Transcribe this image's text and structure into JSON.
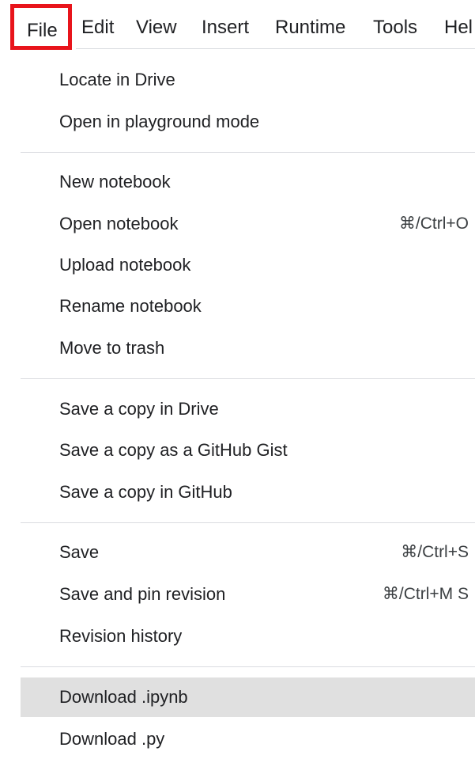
{
  "menubar": {
    "items": [
      {
        "label": "File",
        "active": true
      },
      {
        "label": "Edit"
      },
      {
        "label": "View"
      },
      {
        "label": "Insert"
      },
      {
        "label": "Runtime"
      },
      {
        "label": "Tools"
      },
      {
        "label": "Hel"
      }
    ]
  },
  "menu": {
    "items": [
      {
        "label": "Locate in Drive",
        "shortcut": ""
      },
      {
        "label": "Open in playground mode",
        "shortcut": ""
      },
      {
        "label": "New notebook",
        "shortcut": ""
      },
      {
        "label": "Open notebook",
        "shortcut": "⌘/Ctrl+O"
      },
      {
        "label": "Upload notebook",
        "shortcut": ""
      },
      {
        "label": "Rename notebook",
        "shortcut": ""
      },
      {
        "label": "Move to trash",
        "shortcut": ""
      },
      {
        "label": "Save a copy in Drive",
        "shortcut": ""
      },
      {
        "label": "Save a copy as a GitHub Gist",
        "shortcut": ""
      },
      {
        "label": "Save a copy in GitHub",
        "shortcut": ""
      },
      {
        "label": "Save",
        "shortcut": "⌘/Ctrl+S"
      },
      {
        "label": "Save and pin revision",
        "shortcut": "⌘/Ctrl+M S"
      },
      {
        "label": "Revision history",
        "shortcut": ""
      },
      {
        "label": "Download .ipynb",
        "shortcut": "",
        "highlighted": true
      },
      {
        "label": "Download .py",
        "shortcut": ""
      }
    ]
  },
  "colors": {
    "active_outline": "#e8141b",
    "highlight_bg": "#e0e0e0",
    "separator": "#dadce0",
    "text": "#202124"
  }
}
